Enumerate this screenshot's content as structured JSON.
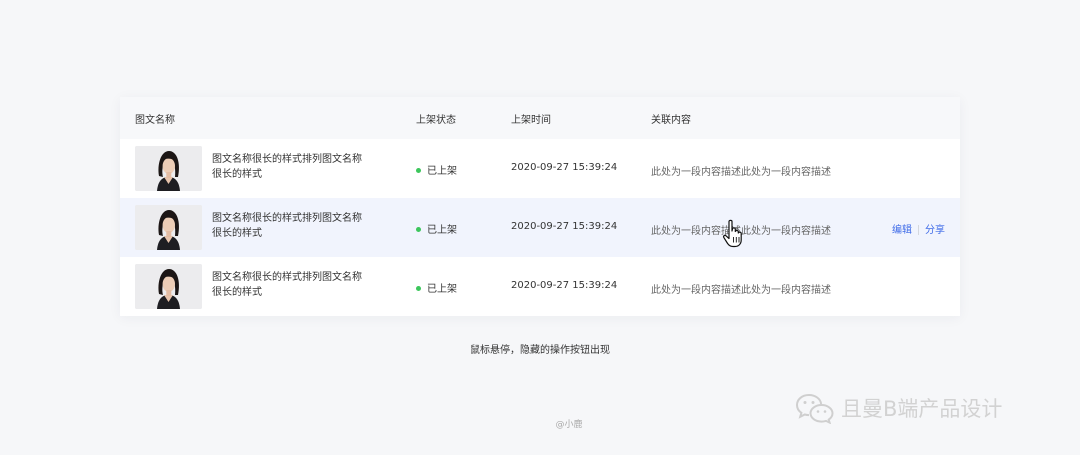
{
  "table": {
    "headers": {
      "name": "图文名称",
      "status": "上架状态",
      "time": "上架时间",
      "related": "关联内容"
    },
    "rows": [
      {
        "title": "图文名称很长的样式排列图文名称很长的样式",
        "status": "已上架",
        "time": "2020-09-27 15:39:24",
        "description": "此处为一段内容描述此处为一段内容描述"
      },
      {
        "title": "图文名称很长的样式排列图文名称很长的样式",
        "status": "已上架",
        "time": "2020-09-27 15:39:24",
        "description": "此处为一段内容描述此处为一段内容描述",
        "actions": {
          "edit": "编辑",
          "share": "分享"
        }
      },
      {
        "title": "图文名称很长的样式排列图文名称很长的样式",
        "status": "已上架",
        "time": "2020-09-27 15:39:24",
        "description": "此处为一段内容描述此处为一段内容描述"
      }
    ]
  },
  "caption": "鼠标悬停，隐藏的操作按钮出现",
  "author": "@小鹿",
  "watermark": "且曼B端产品设计",
  "colors": {
    "accent": "#3f6be8",
    "status_dot": "#3cc65c",
    "hover_row": "#f1f4fd"
  },
  "icons": [
    "hand-pointer-icon",
    "wechat-icon",
    "avatar-photo"
  ]
}
